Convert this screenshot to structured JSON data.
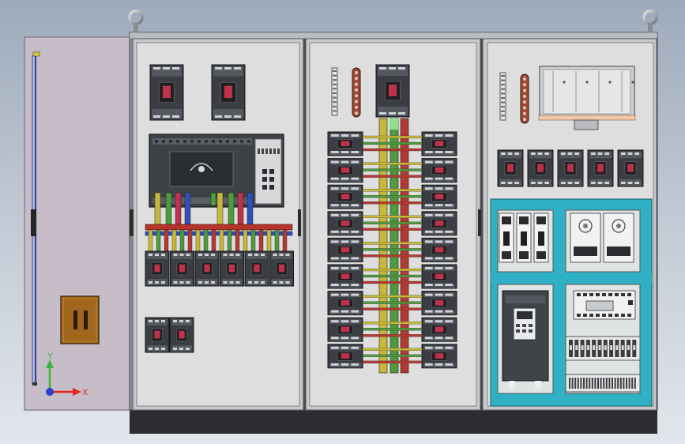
{
  "viewport": {
    "width": 867,
    "height": 562
  },
  "colors": {
    "background_top": "#9eaabb",
    "background_bottom": "#e2e6ec",
    "cabinet_frame": "#9ea3aa",
    "panel_plate": "#dcdcdc",
    "base_plinth": "#2b2d30",
    "door_panel": "#c7bdc9",
    "breaker_body": "#3a3d42",
    "breaker_handle": "#c0324b",
    "busbar_yellow": "#c8b83a",
    "busbar_green": "#4e9a3c",
    "busbar_red": "#b33a30",
    "busbar_blue": "#2f50b8",
    "teal_plate": "#2fb0c4",
    "copper_bar": "#9c4a34",
    "axis_x": "#e0281e",
    "axis_y": "#3cb43c",
    "axis_origin": "#2440d0"
  },
  "view_triad": {
    "x_label": "X",
    "y_label": "Y"
  }
}
